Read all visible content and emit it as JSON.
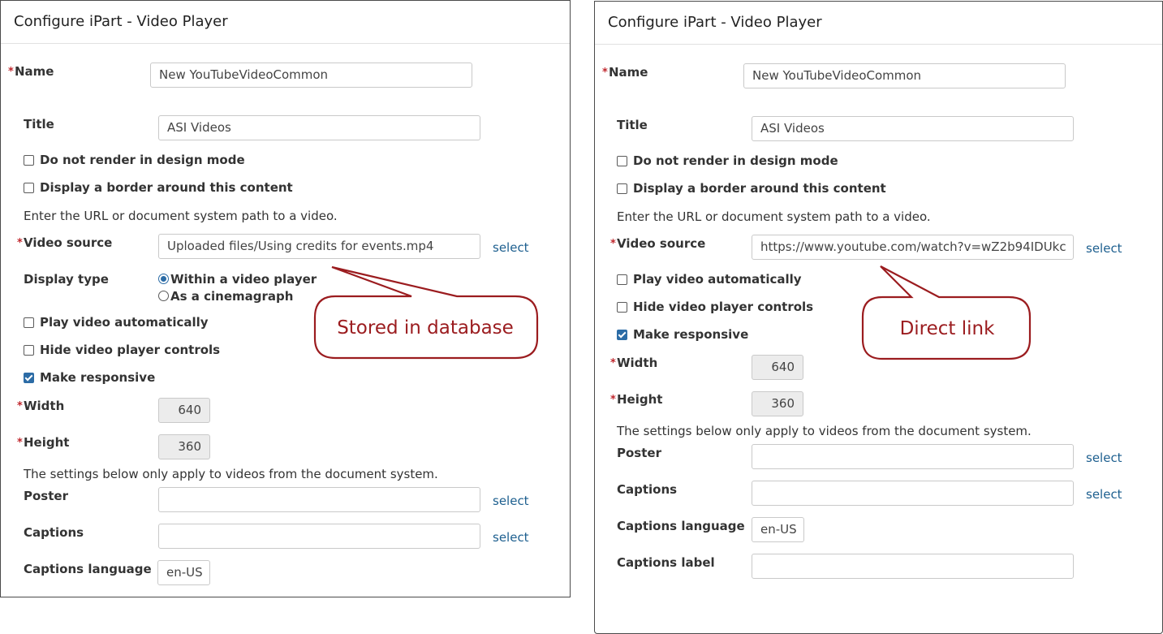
{
  "left_panel": {
    "title": "Configure iPart - Video Player",
    "name_label": "Name",
    "name_value": "New YouTubeVideoCommon",
    "title_label": "Title",
    "title_value": "ASI Videos",
    "no_render_label": "Do not render in design mode",
    "border_label": "Display a border around this content",
    "url_help": "Enter the URL or document system path to a video.",
    "video_source_label": "Video source",
    "video_source_value": "Uploaded files/Using credits for events.mp4",
    "select_label": "select",
    "display_type_label": "Display type",
    "within_player_label": "Within a video player",
    "cinemagraph_label": "As a cinemagraph",
    "autoplay_label": "Play video automatically",
    "hide_controls_label": "Hide video player controls",
    "responsive_label": "Make responsive",
    "width_label": "Width",
    "width_value": "640",
    "height_label": "Height",
    "height_value": "360",
    "doc_help": "The settings below only apply to videos from the document system.",
    "poster_label": "Poster",
    "poster_value": "",
    "captions_label": "Captions",
    "captions_value": "",
    "captions_lang_label": "Captions language",
    "captions_lang_value": "en-US",
    "callout": "Stored in database"
  },
  "right_panel": {
    "title": "Configure iPart - Video Player",
    "name_label": "Name",
    "name_value": "New YouTubeVideoCommon",
    "title_label": "Title",
    "title_value": "ASI Videos",
    "no_render_label": "Do not render in design mode",
    "border_label": "Display a border around this content",
    "url_help": "Enter the URL or document system path to a video.",
    "video_source_label": "Video source",
    "video_source_value": "https://www.youtube.com/watch?v=wZ2b94IDUkc",
    "select_label": "select",
    "autoplay_label": "Play video automatically",
    "hide_controls_label": "Hide video player controls",
    "responsive_label": "Make responsive",
    "width_label": "Width",
    "width_value": "640",
    "height_label": "Height",
    "height_value": "360",
    "doc_help": "The settings below only apply to videos from the document system.",
    "poster_label": "Poster",
    "poster_value": "",
    "captions_label": "Captions",
    "captions_value": "",
    "captions_lang_label": "Captions language",
    "captions_lang_value": "en-US",
    "captions_label_label": "Captions label",
    "captions_label_value": "",
    "callout": "Direct link"
  },
  "required_marker": "*",
  "colors": {
    "required": "#c0272d",
    "link": "#1d5f8f",
    "callout": "#9b1c1f",
    "checkbox_on": "#2c6ca6"
  }
}
